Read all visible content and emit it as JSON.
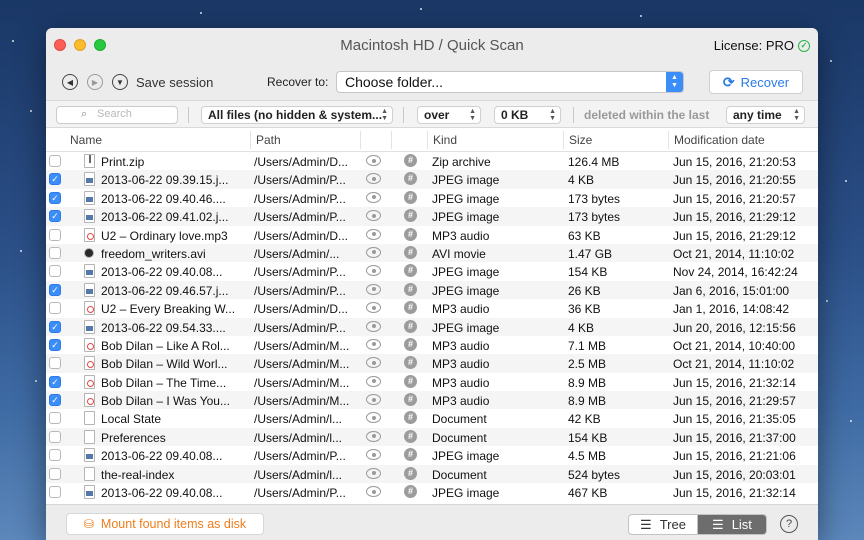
{
  "window": {
    "title": "Macintosh HD / Quick Scan",
    "license": "License: PRO"
  },
  "toolbar": {
    "save_session": "Save session",
    "recover_to_label": "Recover to:",
    "folder_value": "Choose folder...",
    "recover_button": "Recover"
  },
  "filters": {
    "search_placeholder": "Search",
    "file_filter": "All files (no hidden & system...",
    "comparator": "over",
    "size_value": "0 KB",
    "deleted_label": "deleted within the last",
    "time_value": "any time"
  },
  "columns": {
    "name": "Name",
    "path": "Path",
    "kind": "Kind",
    "size": "Size",
    "date": "Modification date"
  },
  "rows": [
    {
      "checked": false,
      "icon": "zip-file-icon",
      "name": "Print.zip",
      "path": "/Users/Admin/D...",
      "kind": "Zip archive",
      "size": "126.4 MB",
      "date": "Jun 15, 2016, 21:20:53"
    },
    {
      "checked": true,
      "icon": "image-file-icon",
      "name": "2013-06-22 09.39.15.j...",
      "path": "/Users/Admin/P...",
      "kind": "JPEG image",
      "size": "4 KB",
      "date": "Jun 15, 2016, 21:20:55"
    },
    {
      "checked": true,
      "icon": "image-file-icon",
      "name": "2013-06-22 09.40.46....",
      "path": "/Users/Admin/P...",
      "kind": "JPEG image",
      "size": "173 bytes",
      "date": "Jun 15, 2016, 21:20:57"
    },
    {
      "checked": true,
      "icon": "image-file-icon",
      "name": "2013-06-22 09.41.02.j...",
      "path": "/Users/Admin/P...",
      "kind": "JPEG image",
      "size": "173 bytes",
      "date": "Jun 15, 2016, 21:29:12"
    },
    {
      "checked": false,
      "icon": "audio-file-icon",
      "name": "U2 – Ordinary love.mp3",
      "path": "/Users/Admin/D...",
      "kind": "MP3 audio",
      "size": "63 KB",
      "date": "Jun 15, 2016, 21:29:12"
    },
    {
      "checked": false,
      "icon": "video-file-icon",
      "name": "freedom_writers.avi",
      "path": "/Users/Admin/...",
      "kind": "AVI movie",
      "size": "1.47 GB",
      "date": "Oct 21, 2014, 11:10:02"
    },
    {
      "checked": false,
      "icon": "image-file-icon",
      "name": "2013-06-22 09.40.08...",
      "path": "/Users/Admin/P...",
      "kind": "JPEG image",
      "size": "154 KB",
      "date": "Nov 24, 2014, 16:42:24"
    },
    {
      "checked": true,
      "icon": "image-file-icon",
      "name": "2013-06-22 09.46.57.j...",
      "path": "/Users/Admin/P...",
      "kind": "JPEG image",
      "size": "26 KB",
      "date": "Jan 6, 2016, 15:01:00"
    },
    {
      "checked": false,
      "icon": "audio-file-icon",
      "name": "U2 – Every Breaking W...",
      "path": "/Users/Admin/D...",
      "kind": "MP3 audio",
      "size": "36 KB",
      "date": "Jan 1, 2016, 14:08:42"
    },
    {
      "checked": true,
      "icon": "image-file-icon",
      "name": "2013-06-22 09.54.33....",
      "path": "/Users/Admin/P...",
      "kind": "JPEG image",
      "size": "4 KB",
      "date": "Jun 20, 2016, 12:15:56"
    },
    {
      "checked": true,
      "icon": "audio-file-icon",
      "name": "Bob Dilan – Like A Rol...",
      "path": "/Users/Admin/M...",
      "kind": "MP3 audio",
      "size": "7.1 MB",
      "date": "Oct 21, 2014, 10:40:00"
    },
    {
      "checked": false,
      "icon": "audio-file-icon",
      "name": "Bob Dilan – Wild Worl...",
      "path": "/Users/Admin/M...",
      "kind": "MP3 audio",
      "size": "2.5 MB",
      "date": "Oct 21, 2014, 11:10:02"
    },
    {
      "checked": true,
      "icon": "audio-file-icon",
      "name": "Bob Dilan – The Time...",
      "path": "/Users/Admin/M...",
      "kind": "MP3 audio",
      "size": "8.9 MB",
      "date": "Jun 15, 2016, 21:32:14"
    },
    {
      "checked": true,
      "icon": "audio-file-icon",
      "name": "Bob Dilan – I Was You...",
      "path": "/Users/Admin/M...",
      "kind": "MP3 audio",
      "size": "8.9 MB",
      "date": "Jun 15, 2016, 21:29:57"
    },
    {
      "checked": false,
      "icon": "document-file-icon",
      "name": "Local State",
      "path": "/Users/Admin/l...",
      "kind": "Document",
      "size": "42 KB",
      "date": "Jun 15, 2016, 21:35:05"
    },
    {
      "checked": false,
      "icon": "document-file-icon",
      "name": "Preferences",
      "path": "/Users/Admin/l...",
      "kind": "Document",
      "size": "154 KB",
      "date": "Jun 15, 2016, 21:37:00"
    },
    {
      "checked": false,
      "icon": "image-file-icon",
      "name": "2013-06-22 09.40.08...",
      "path": "/Users/Admin/P...",
      "kind": "JPEG image",
      "size": "4.5 MB",
      "date": "Jun 15, 2016, 21:21:06"
    },
    {
      "checked": false,
      "icon": "document-file-icon",
      "name": "the-real-index",
      "path": "/Users/Admin/l...",
      "kind": "Document",
      "size": "524 bytes",
      "date": "Jun 15, 2016, 20:03:01"
    },
    {
      "checked": false,
      "icon": "image-file-icon",
      "name": "2013-06-22 09.40.08...",
      "path": "/Users/Admin/P...",
      "kind": "JPEG image",
      "size": "467 KB",
      "date": "Jun 15, 2016, 21:32:14"
    }
  ],
  "bottom": {
    "mount_button": "Mount found items as disk",
    "tree_label": "Tree",
    "list_label": "List",
    "help": "?"
  },
  "colors": {
    "accent": "#3b8dfa",
    "recover_text": "#2a7be4",
    "mount_text": "#ee7d1c"
  }
}
